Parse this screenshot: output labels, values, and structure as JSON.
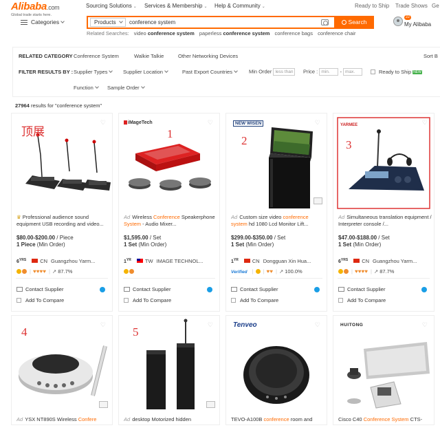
{
  "header": {
    "logo_text": "Alibaba",
    "logo_suffix": ".com",
    "logo_tagline": "Global trade starts here.",
    "nav": [
      "Sourcing Solutions",
      "Services & Membership",
      "Help & Community"
    ],
    "top_right": [
      "Ready to Ship",
      "Trade Shows",
      "Ge"
    ],
    "categories_label": "Categories",
    "search_scope": "Products",
    "search_value": "conference system",
    "search_button": "Search",
    "related_label": "Related Searches:",
    "related": [
      {
        "pre": "video ",
        "kw": "conference system",
        "post": ""
      },
      {
        "pre": "paperless ",
        "kw": "conference system",
        "post": ""
      },
      {
        "pre": "conference bags",
        "kw": "",
        "post": ""
      },
      {
        "pre": "conference chair",
        "kw": "",
        "post": ""
      }
    ],
    "my_alibaba": "My Alibaba",
    "message_count": "22"
  },
  "filters": {
    "related_category_label": "RELATED CATEGORY",
    "categories": [
      "Conference System",
      "Walkie Talkie",
      "Other Networking Devices"
    ],
    "sort_label": "Sort B",
    "filter_by_label": "FILTER RESULTS BY :",
    "supplier_types": "Supplier Types",
    "supplier_location": "Supplier Location",
    "past_export": "Past Export Countries",
    "min_order_label": "Min Order",
    "min_order_placeholder": "less than",
    "price_label": "Price",
    "price_min_placeholder": "min.",
    "price_dash": "-",
    "price_max_placeholder": "max.",
    "ready_to_ship": "Ready to Ship",
    "new_tag": "NEW",
    "function": "Function",
    "sample_order": "Sample Order"
  },
  "results": {
    "count": "27964",
    "text": " results for \"conference system\""
  },
  "products": [
    {
      "handwritten": "顶展",
      "brand": "",
      "ad": "",
      "crown": "♛",
      "title_pre": "Professional audience sound equipment USB recording and video...",
      "title_kw": "",
      "title_post": "",
      "title_kw2": "",
      "title_post2": "",
      "price": "$80.00-$200.00",
      "unit": " / Piece",
      "moq_qty": "1 Piece",
      "moq_label": " (Min Order)",
      "years": "6",
      "yrs_unit": "YRS",
      "country": "CN",
      "supplier": "Guangzhou Yarm...",
      "verified": "",
      "rating_icons": "♥♥♥♥",
      "response": "87.7%",
      "contact": "Contact Supplier",
      "compare": "Add To Compare"
    },
    {
      "handwritten": "1",
      "brand": "iMageTech",
      "ad": "Ad",
      "crown": "",
      "title_pre": "Wireless ",
      "title_kw": "Conference",
      "title_post": " Speakerphone ",
      "title_kw2": "System",
      "title_post2": " - Audio Mixer...",
      "price": "$1,595.00",
      "unit": " / Set",
      "moq_qty": "1 Set",
      "moq_label": " (Min Order)",
      "years": "1",
      "yrs_unit": "YR",
      "country": "TW",
      "supplier": "IMAGE TECHNOL...",
      "verified": "",
      "rating_icons": "",
      "response": "",
      "contact": "Contact Supplier",
      "compare": "Add To Compare"
    },
    {
      "handwritten": "2",
      "brand": "NEW WISEN",
      "ad": "Ad",
      "crown": "",
      "title_pre": "Custom size video ",
      "title_kw": "conference system",
      "title_post": " hd 1080 Lcd Monitor Lift...",
      "title_kw2": "",
      "title_post2": "",
      "price": "$299.00-$350.00",
      "unit": " / Set",
      "moq_qty": "1 Set",
      "moq_label": " (Min Order)",
      "years": "1",
      "yrs_unit": "YR",
      "country": "CN",
      "supplier": "Dongguan Xin Hua...",
      "verified": "Verified",
      "rating_icons": "♥♥",
      "response": "100.0%",
      "contact": "Contact Supplier",
      "compare": "Add To Compare"
    },
    {
      "handwritten": "3",
      "brand": "YARMEE",
      "ad": "Ad",
      "crown": "",
      "title_pre": "Simultaneous translation equipment / Interpreter console /...",
      "title_kw": "",
      "title_post": "",
      "title_kw2": "",
      "title_post2": "",
      "price": "$47.00-$188.00",
      "unit": " / Set",
      "moq_qty": "1 Set",
      "moq_label": " (Min Order)",
      "years": "6",
      "yrs_unit": "YRS",
      "country": "CN",
      "supplier": "Guangzhou Yarm...",
      "verified": "",
      "rating_icons": "♥♥♥♥",
      "response": "87.7%",
      "contact": "Contact Supplier",
      "compare": "Add To Compare"
    },
    {
      "handwritten": "4",
      "brand": "",
      "ad": "Ad",
      "crown": "",
      "title_pre": "YSX NT890S Wireless ",
      "title_kw": "Confere",
      "title_post": "",
      "title_kw2": "",
      "title_post2": ""
    },
    {
      "handwritten": "5",
      "brand": "",
      "ad": "Ad",
      "crown": "",
      "title_pre": "desktop Motorized hidden",
      "title_kw": "",
      "title_post": "",
      "title_kw2": "",
      "title_post2": ""
    },
    {
      "handwritten": "",
      "brand": "Tenveo",
      "ad": "",
      "crown": "",
      "title_pre": "TEVO-A100B ",
      "title_kw": "conference",
      "title_post": " room and",
      "title_kw2": "",
      "title_post2": ""
    },
    {
      "handwritten": "",
      "brand": "HUITONG",
      "ad": "",
      "crown": "",
      "title_pre": "Cisco C40 ",
      "title_kw": "Conference System",
      "title_post": " CTS-",
      "title_kw2": "",
      "title_post2": ""
    }
  ],
  "colors": {
    "accent": "#ff6a00",
    "handwriting": "#dd3333",
    "chat": "#1a9ee6"
  }
}
